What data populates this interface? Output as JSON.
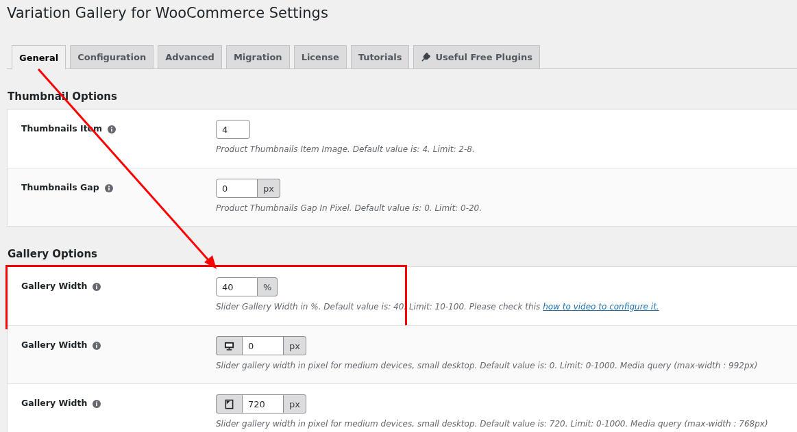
{
  "title": "Variation Gallery for WooCommerce Settings",
  "tabs": [
    {
      "label": "General",
      "selected": true
    },
    {
      "label": "Configuration",
      "selected": false
    },
    {
      "label": "Advanced",
      "selected": false
    },
    {
      "label": "Migration",
      "selected": false
    },
    {
      "label": "License",
      "selected": false
    },
    {
      "label": "Tutorials",
      "selected": false
    },
    {
      "label": "Useful Free Plugins",
      "selected": false,
      "plug_icon": true
    }
  ],
  "sections": [
    {
      "heading": "Thumbnail Options",
      "rows": [
        {
          "label": "Thumbnails Item",
          "kind": "number",
          "value": "4",
          "description": "Product Thumbnails Item Image. Default value is: 4. Limit: 2-8."
        },
        {
          "label": "Thumbnails Gap",
          "kind": "unit",
          "value": "0",
          "unit": "px",
          "description": "Product Thumbnails Gap In Pixel. Default value is: 0. Limit: 0-20."
        }
      ]
    },
    {
      "heading": "Gallery Options",
      "rows": [
        {
          "label": "Gallery Width",
          "kind": "unit",
          "value": "40",
          "unit": "%",
          "description": "Slider Gallery Width in %. Default value is: 40. Limit: 10-100. Please check this",
          "link": "how to video to configure it.",
          "highlighted": true
        },
        {
          "label": "Gallery Width",
          "kind": "desktop",
          "value": "0",
          "unit": "px",
          "description": "Slider gallery width in pixel for medium devices, small desktop. Default value is: 0. Limit: 0-1000. Media query (max-width : 992px)"
        },
        {
          "label": "Gallery Width",
          "kind": "tablet",
          "value": "720",
          "unit": "px",
          "description": "Slider gallery width in pixel for medium devices, small desktop. Default value is: 720. Limit: 0-1000. Media query (max-width : 768px)"
        }
      ]
    }
  ],
  "arrow": true
}
